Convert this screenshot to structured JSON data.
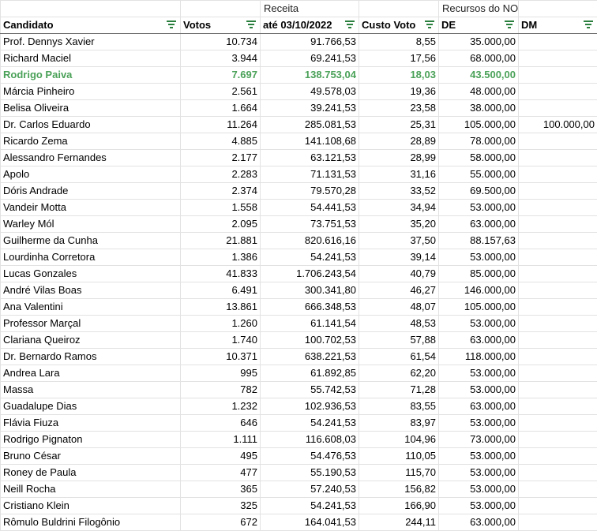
{
  "group_headers": {
    "receita": "Receita",
    "recursos": "Recursos do NOVO"
  },
  "columns": {
    "candidato": "Candidato",
    "votos": "Votos",
    "receita": "até 03/10/2022",
    "custo": "Custo Voto",
    "de": "DE",
    "dm": "DM"
  },
  "highlight_color": "#4aa158",
  "filter_icon_color": "#2a7f3e",
  "rows": [
    {
      "nome": "Prof. Dennys Xavier",
      "votos": "10.734",
      "receita": "91.766,53",
      "custo": "8,55",
      "de": "35.000,00",
      "dm": ""
    },
    {
      "nome": "Richard Maciel",
      "votos": "3.944",
      "receita": "69.241,53",
      "custo": "17,56",
      "de": "68.000,00",
      "dm": ""
    },
    {
      "nome": "Rodrigo Paiva",
      "votos": "7.697",
      "receita": "138.753,04",
      "custo": "18,03",
      "de": "43.500,00",
      "dm": "",
      "highlight": true
    },
    {
      "nome": "Márcia Pinheiro",
      "votos": "2.561",
      "receita": "49.578,03",
      "custo": "19,36",
      "de": "48.000,00",
      "dm": ""
    },
    {
      "nome": "Belisa Oliveira",
      "votos": "1.664",
      "receita": "39.241,53",
      "custo": "23,58",
      "de": "38.000,00",
      "dm": ""
    },
    {
      "nome": "Dr. Carlos Eduardo",
      "votos": "11.264",
      "receita": "285.081,53",
      "custo": "25,31",
      "de": "105.000,00",
      "dm": "100.000,00"
    },
    {
      "nome": "Ricardo Zema",
      "votos": "4.885",
      "receita": "141.108,68",
      "custo": "28,89",
      "de": "78.000,00",
      "dm": ""
    },
    {
      "nome": "Alessandro Fernandes",
      "votos": "2.177",
      "receita": "63.121,53",
      "custo": "28,99",
      "de": "58.000,00",
      "dm": ""
    },
    {
      "nome": "Apolo",
      "votos": "2.283",
      "receita": "71.131,53",
      "custo": "31,16",
      "de": "55.000,00",
      "dm": ""
    },
    {
      "nome": "Dóris Andrade",
      "votos": "2.374",
      "receita": "79.570,28",
      "custo": "33,52",
      "de": "69.500,00",
      "dm": ""
    },
    {
      "nome": "Vandeir Motta",
      "votos": "1.558",
      "receita": "54.441,53",
      "custo": "34,94",
      "de": "53.000,00",
      "dm": ""
    },
    {
      "nome": "Warley Mól",
      "votos": "2.095",
      "receita": "73.751,53",
      "custo": "35,20",
      "de": "63.000,00",
      "dm": ""
    },
    {
      "nome": "Guilherme da Cunha",
      "votos": "21.881",
      "receita": "820.616,16",
      "custo": "37,50",
      "de": "88.157,63",
      "dm": ""
    },
    {
      "nome": "Lourdinha Corretora",
      "votos": "1.386",
      "receita": "54.241,53",
      "custo": "39,14",
      "de": "53.000,00",
      "dm": ""
    },
    {
      "nome": "Lucas Gonzales",
      "votos": "41.833",
      "receita": "1.706.243,54",
      "custo": "40,79",
      "de": "85.000,00",
      "dm": ""
    },
    {
      "nome": "André Vilas Boas",
      "votos": "6.491",
      "receita": "300.341,80",
      "custo": "46,27",
      "de": "146.000,00",
      "dm": ""
    },
    {
      "nome": "Ana Valentini",
      "votos": "13.861",
      "receita": "666.348,53",
      "custo": "48,07",
      "de": "105.000,00",
      "dm": ""
    },
    {
      "nome": "Professor Marçal",
      "votos": "1.260",
      "receita": "61.141,54",
      "custo": "48,53",
      "de": "53.000,00",
      "dm": ""
    },
    {
      "nome": "Clariana Queiroz",
      "votos": "1.740",
      "receita": "100.702,53",
      "custo": "57,88",
      "de": "63.000,00",
      "dm": ""
    },
    {
      "nome": "Dr. Bernardo Ramos",
      "votos": "10.371",
      "receita": "638.221,53",
      "custo": "61,54",
      "de": "118.000,00",
      "dm": ""
    },
    {
      "nome": "Andrea Lara",
      "votos": "995",
      "receita": "61.892,85",
      "custo": "62,20",
      "de": "53.000,00",
      "dm": ""
    },
    {
      "nome": "Massa",
      "votos": "782",
      "receita": "55.742,53",
      "custo": "71,28",
      "de": "53.000,00",
      "dm": ""
    },
    {
      "nome": "Guadalupe Dias",
      "votos": "1.232",
      "receita": "102.936,53",
      "custo": "83,55",
      "de": "63.000,00",
      "dm": ""
    },
    {
      "nome": "Flávia Fiuza",
      "votos": "646",
      "receita": "54.241,53",
      "custo": "83,97",
      "de": "53.000,00",
      "dm": ""
    },
    {
      "nome": "Rodrigo Pignaton",
      "votos": "1.111",
      "receita": "116.608,03",
      "custo": "104,96",
      "de": "73.000,00",
      "dm": ""
    },
    {
      "nome": "Bruno César",
      "votos": "495",
      "receita": "54.476,53",
      "custo": "110,05",
      "de": "53.000,00",
      "dm": ""
    },
    {
      "nome": "Roney de Paula",
      "votos": "477",
      "receita": "55.190,53",
      "custo": "115,70",
      "de": "53.000,00",
      "dm": ""
    },
    {
      "nome": "Neill Rocha",
      "votos": "365",
      "receita": "57.240,53",
      "custo": "156,82",
      "de": "53.000,00",
      "dm": ""
    },
    {
      "nome": "Cristiano Klein",
      "votos": "325",
      "receita": "54.241,53",
      "custo": "166,90",
      "de": "53.000,00",
      "dm": ""
    },
    {
      "nome": "Rômulo Buldrini Filogônio",
      "votos": "672",
      "receita": "164.041,53",
      "custo": "244,11",
      "de": "63.000,00",
      "dm": ""
    }
  ]
}
